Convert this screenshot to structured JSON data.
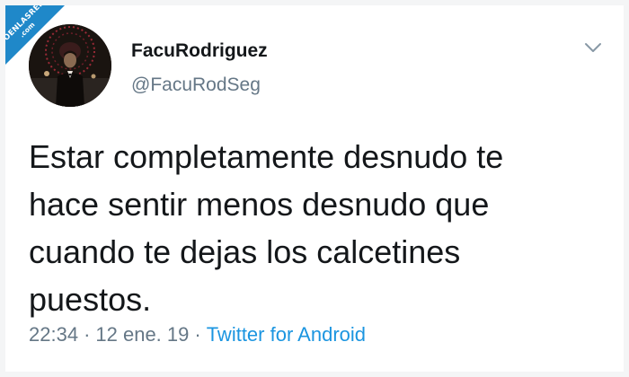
{
  "watermark": {
    "line1": "VISTOENLASREDES",
    "line2": ".com"
  },
  "tweet": {
    "author": {
      "display_name": "FacuRodriguez",
      "handle": "@FacuRodSeg"
    },
    "text": "Estar completamente desnudo te\nhace sentir menos desnudo que\ncuando te dejas los calcetines\npuestos.",
    "time": "22:34",
    "separator": "·",
    "date": "12 ene. 19",
    "source": "Twitter for Android"
  },
  "icons": {
    "menu": "chevron-down-icon",
    "avatar": "profile-photo"
  },
  "colors": {
    "name": "#14171a",
    "secondary": "#657786",
    "link": "#1b95e0",
    "watermark": "#1f88c9"
  }
}
